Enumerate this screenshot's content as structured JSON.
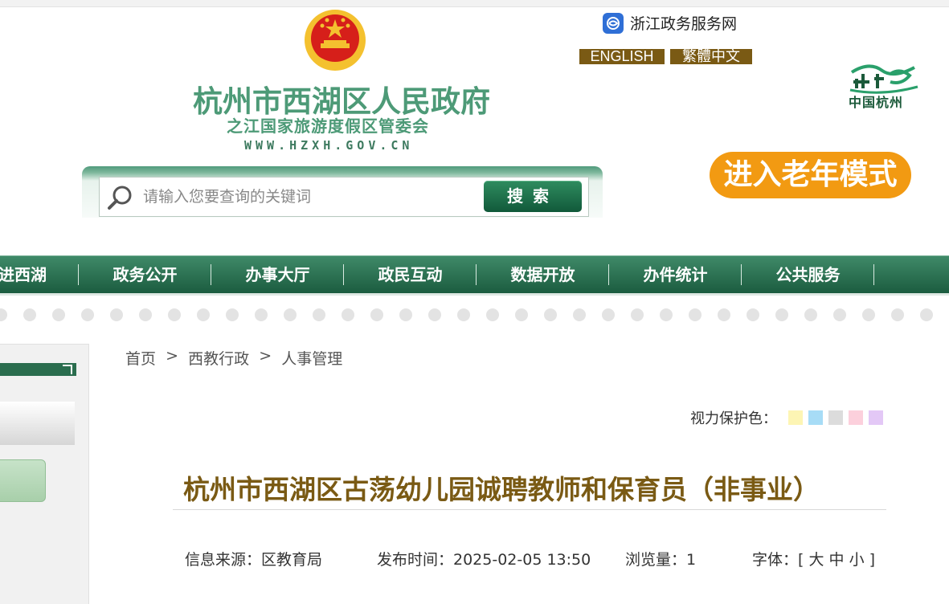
{
  "header": {
    "title": "杭州市西湖区人民政府",
    "subtitle": "之江国家旅游度假区管委会",
    "url_text": "WWW.HZXH.GOV.CN",
    "zj_link": "浙江政务服务网",
    "lang_en": "ENGLISH",
    "lang_tw": "繁體中文",
    "city_logo_text": "中国杭州",
    "elder_mode": "进入老年模式",
    "colors": {
      "green": "#4d9a77",
      "brown": "#7a5a14",
      "orange": "#f29a12"
    }
  },
  "search": {
    "placeholder": "请输入您要查询的关键词",
    "button": "搜索"
  },
  "nav": {
    "items": [
      "进西湖",
      "政务公开",
      "办事大厅",
      "政民互动",
      "数据开放",
      "办件统计",
      "公共服务"
    ]
  },
  "breadcrumb": {
    "items": [
      "首页",
      "西教行政",
      "人事管理"
    ],
    "separator": ">"
  },
  "eye_protect": {
    "label": "视力保护色：",
    "colors": [
      "#fdf5b4",
      "#a7dcf6",
      "#dcdcdc",
      "#fcd0dc",
      "#e3c8f6"
    ]
  },
  "article": {
    "title": "杭州市西湖区古荡幼儿园诚聘教师和保育员（非事业）",
    "source": "信息来源：区教育局",
    "publish_time": "发布时间：2025-02-05 13:50",
    "views": "浏览量：1",
    "font_label": "字体：",
    "font_large": "大",
    "font_medium": "中",
    "font_small": "小"
  }
}
